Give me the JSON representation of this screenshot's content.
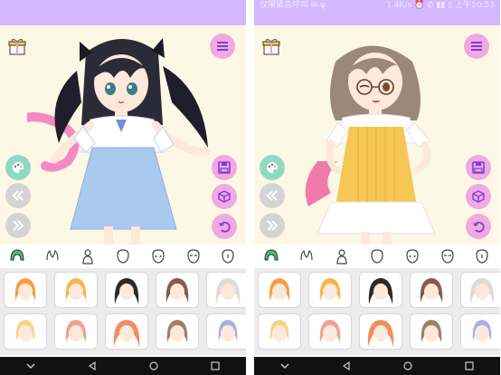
{
  "left_screen": {
    "statusbar": {
      "left_text": "",
      "right_text": ""
    },
    "character": "twin-tail-girl-blue-dress"
  },
  "right_screen": {
    "statusbar": {
      "left_text": "仅限紧急呼叫 ✉ ψ",
      "right_text": "1.4K/s ⏰ ✆ ▮▮ ▯ 上午10:53"
    },
    "character": "glasses-girl-yellow-dress"
  },
  "toolbar": {
    "gift_icon": "gift-icon",
    "menu_icon": "hamburger-menu-icon",
    "palette_icon": "palette-icon",
    "rewind_icon": "rewind-icon",
    "forward_icon": "fast-forward-icon",
    "save_icon": "save-icon",
    "cube_icon": "cube-icon",
    "undo_icon": "undo-icon"
  },
  "categories": [
    "hair-front",
    "hair-accessory",
    "body",
    "face-shape",
    "eyes",
    "eyebrows",
    "mouth"
  ],
  "hair_swatches": [
    {
      "color": "#f5a040"
    },
    {
      "color": "#f7b54a"
    },
    {
      "color": "#2b2b2b"
    },
    {
      "color": "#8a5a48"
    },
    {
      "color": "#dcdcdc"
    },
    {
      "color": "#f4d48a"
    },
    {
      "color": "#f2a090"
    },
    {
      "color": "#f08f60"
    },
    {
      "color": "#9c8068"
    },
    {
      "color": "#a6b0e6"
    }
  ],
  "colors": {
    "statusbar": "#d3b8ff",
    "stage_bg": "#fdf8e6",
    "grid_bg": "#ececec",
    "nav_bg": "#111111"
  }
}
